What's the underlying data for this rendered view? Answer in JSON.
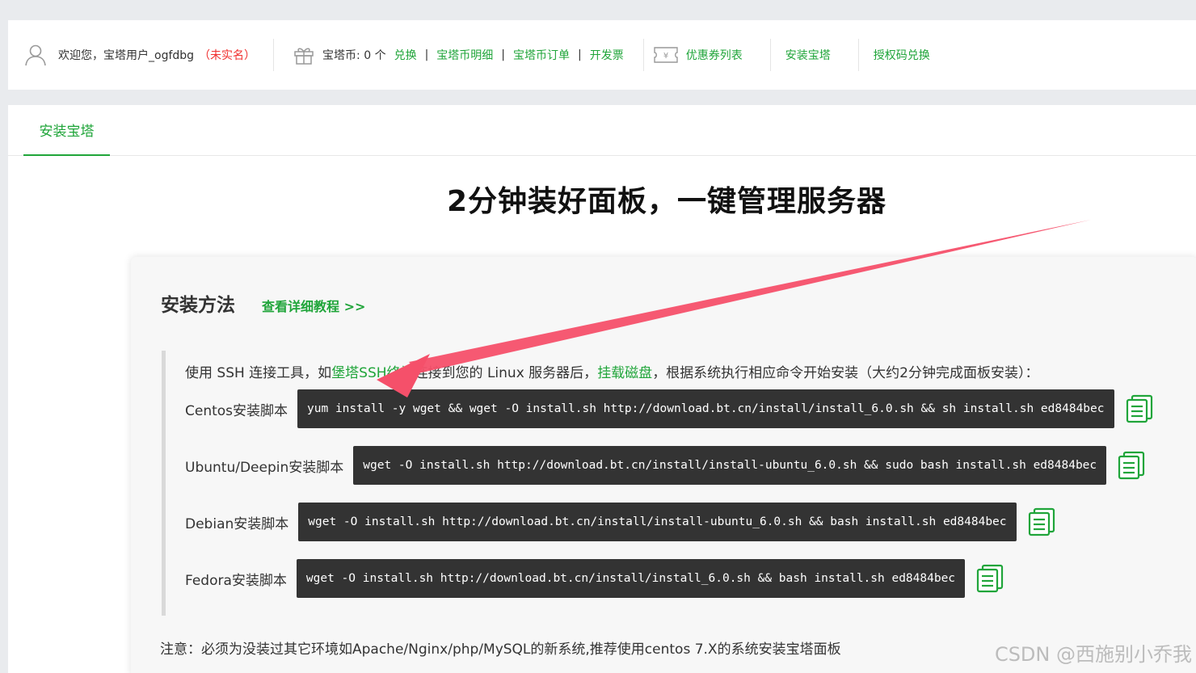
{
  "topbar": {
    "welcome": "欢迎您，宝塔用户_ogfdbg",
    "unverified": "（未实名）",
    "coins": "宝塔币: 0 个",
    "exchange": "兑换",
    "coin_detail": "宝塔币明细",
    "coin_orders": "宝塔币订单",
    "invoice": "开发票",
    "coupons": "优惠券列表",
    "install": "安装宝塔",
    "auth_code": "授权码兑换",
    "separator": "|"
  },
  "tabs": [
    {
      "label": "安装宝塔"
    }
  ],
  "headline": "2分钟装好面板，一键管理服务器",
  "card": {
    "title": "安装方法",
    "tutorial_link": "查看详细教程 >>",
    "intro": {
      "before": "使用 SSH 连接工具，如",
      "link1": "堡塔SSH终端",
      "middle": "连接到您的 Linux 服务器后，",
      "link2": "挂载磁盘",
      "after": "，根据系统执行相应命令开始安装（大约2分钟完成面板安装）："
    },
    "scripts": [
      {
        "label": "Centos安装脚本",
        "command": "yum install -y wget && wget -O install.sh http://download.bt.cn/install/install_6.0.sh && sh install.sh ed8484bec"
      },
      {
        "label": "Ubuntu/Deepin安装脚本",
        "command": "wget -O install.sh http://download.bt.cn/install/install-ubuntu_6.0.sh && sudo bash install.sh ed8484bec"
      },
      {
        "label": "Debian安装脚本",
        "command": "wget -O install.sh http://download.bt.cn/install/install-ubuntu_6.0.sh && bash install.sh ed8484bec"
      },
      {
        "label": "Fedora安装脚本",
        "command": "wget -O install.sh http://download.bt.cn/install/install_6.0.sh && bash install.sh ed8484bec"
      }
    ],
    "note": "注意：必须为没装过其它环境如Apache/Nginx/php/MySQL的新系统,推荐使用centos 7.X的系统安装宝塔面板"
  },
  "watermark": "CSDN @西施别小乔我",
  "colors": {
    "accent": "#20a53a",
    "warning": "#f0302f",
    "arrow": "#f5506a",
    "code_bg": "#333333"
  }
}
